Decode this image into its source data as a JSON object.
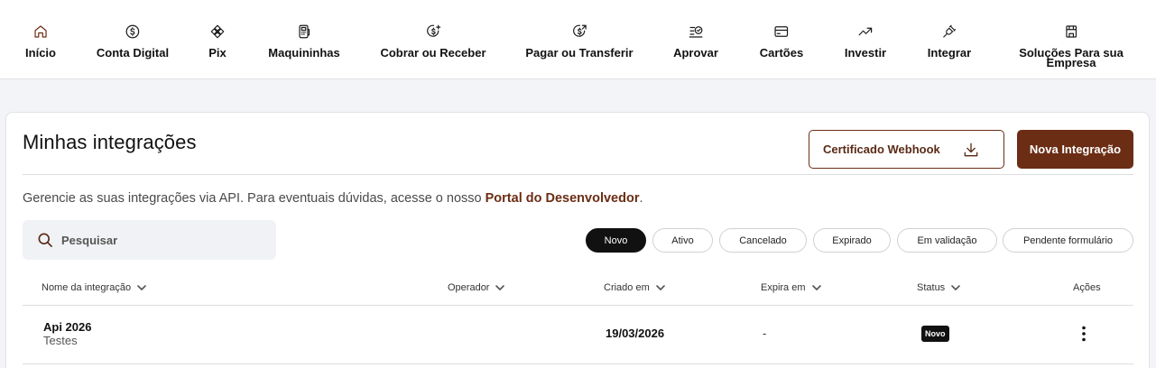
{
  "nav": {
    "items": [
      {
        "label": "Início",
        "icon": "home-icon"
      },
      {
        "label": "Conta Digital",
        "icon": "dollar-circle-icon"
      },
      {
        "label": "Pix",
        "icon": "pix-icon"
      },
      {
        "label": "Maquininhas",
        "icon": "card-machine-icon"
      },
      {
        "label": "Cobrar ou Receber",
        "icon": "receive-money-icon"
      },
      {
        "label": "Pagar ou Transferir",
        "icon": "send-money-icon"
      },
      {
        "label": "Aprovar",
        "icon": "approve-list-icon"
      },
      {
        "label": "Cartões",
        "icon": "credit-card-icon"
      },
      {
        "label": "Investir",
        "icon": "trending-up-icon"
      },
      {
        "label": "Integrar",
        "icon": "plug-icon"
      },
      {
        "label": "Soluções Para sua",
        "label2": "Empresa",
        "icon": "store-icon"
      }
    ]
  },
  "page": {
    "title": "Minhas integrações",
    "webhook_button": "Certificado Webhook",
    "new_button": "Nova Integração",
    "description": "Gerencie as suas integrações via API. Para eventuais dúvidas, acesse o nosso ",
    "description_link": "Portal do Desenvolvedor",
    "description_end": ".",
    "search_placeholder": "Pesquisar"
  },
  "filters": [
    "Novo",
    "Ativo",
    "Cancelado",
    "Expirado",
    "Em validação",
    "Pendente formulário"
  ],
  "active_filter": "Novo",
  "table": {
    "headers": {
      "name": "Nome da integração",
      "operator": "Operador",
      "created": "Criado em",
      "expires": "Expira em",
      "status": "Status",
      "actions": "Ações"
    },
    "rows": [
      {
        "name": "Api 2026",
        "subtitle": "Testes",
        "operator": "",
        "created": "19/03/2026",
        "expires": "-",
        "status": "Novo"
      }
    ]
  },
  "colors": {
    "accent": "#6b2d14",
    "background": "#f3f4f7",
    "active_chip": "#111111"
  }
}
